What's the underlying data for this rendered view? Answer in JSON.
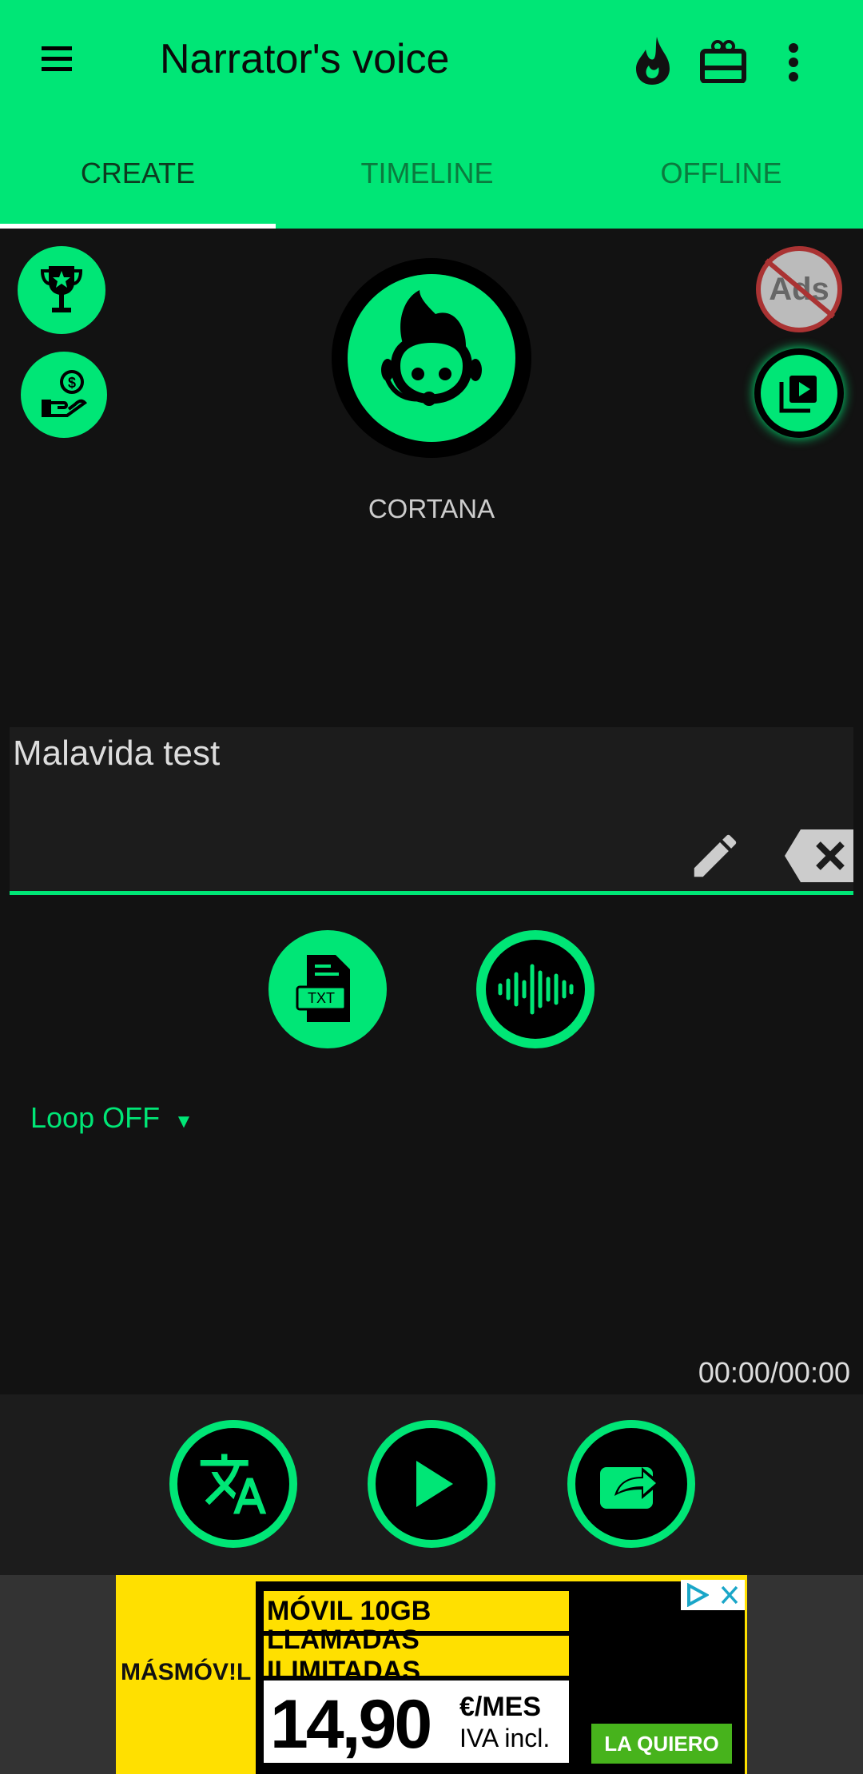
{
  "colors": {
    "accent": "#00e676",
    "background": "#121212"
  },
  "toolbar": {
    "title": "Narrator's voice",
    "menu_icon": "hamburger-icon",
    "icons": [
      "flame-icon",
      "gift-card-icon",
      "more-vert-icon"
    ]
  },
  "tabs": [
    {
      "label": "CREATE",
      "selected": true
    },
    {
      "label": "TIMELINE",
      "selected": false
    },
    {
      "label": "OFFLINE",
      "selected": false
    }
  ],
  "voice": {
    "name": "CORTANA"
  },
  "no_ads": {
    "label": "Ads"
  },
  "text_input": {
    "value": "Malavida test"
  },
  "loop": {
    "label": "Loop OFF",
    "arrow": "▼"
  },
  "player": {
    "time": "00:00/00:00"
  },
  "ad": {
    "brand": "MÁSMÓV!L",
    "line1": "MÓVIL 10GB",
    "line2": "LLAMADAS ILIMITADAS",
    "price": "14,90",
    "unit": "€/MES",
    "tax": "IVA incl.",
    "cta": "LA QUIERO"
  }
}
